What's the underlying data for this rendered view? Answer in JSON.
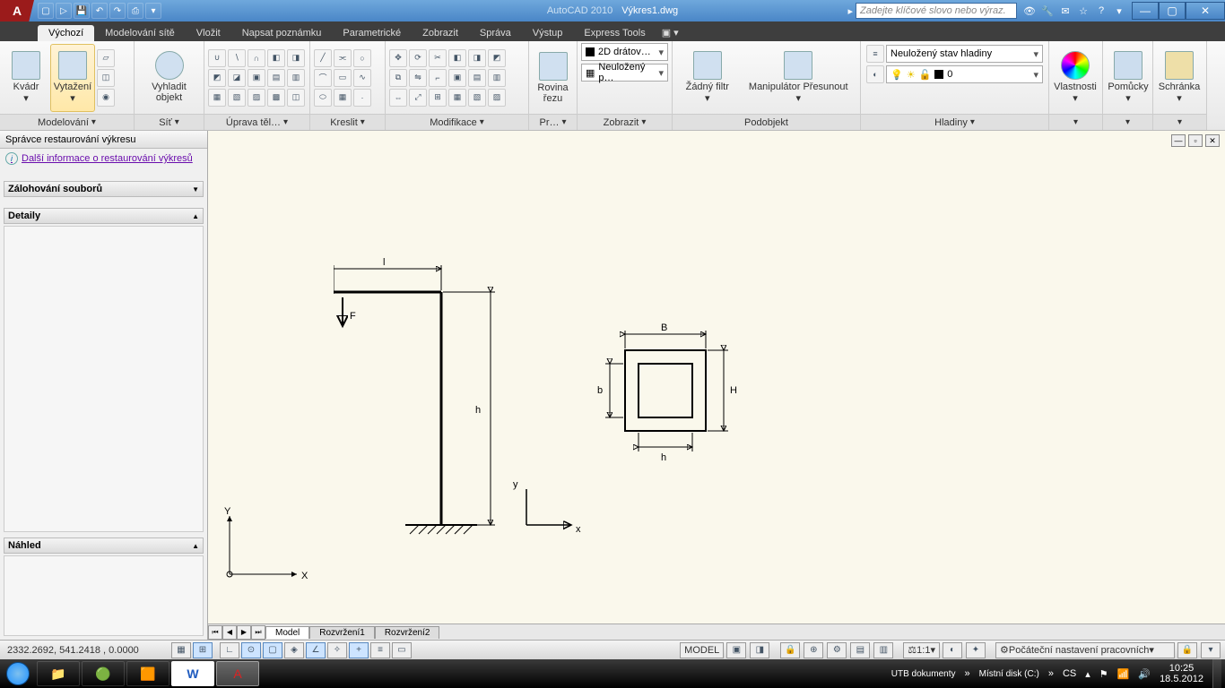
{
  "titlebar": {
    "app_name": "AutoCAD 2010",
    "doc_name": "Výkres1.dwg",
    "search_placeholder": "Zadejte klíčové slovo nebo výraz."
  },
  "tabs": {
    "items": [
      "Výchozí",
      "Modelování sítě",
      "Vložit",
      "Napsat poznámku",
      "Parametrické",
      "Zobrazit",
      "Správa",
      "Výstup",
      "Express Tools"
    ],
    "active_index": 0
  },
  "ribbon": {
    "panels": {
      "modeling": {
        "title": "Modelování",
        "btn1": "Kvádr",
        "btn2": "Vytažení",
        "btn3": "Vyhladit objekt"
      },
      "mesh": {
        "title": "Síť"
      },
      "edit": {
        "title": "Úprava těl…"
      },
      "draw": {
        "title": "Kreslit"
      },
      "modify": {
        "title": "Modifikace"
      },
      "section": {
        "title": "Pr…",
        "btn": "Rovina řezu"
      },
      "view": {
        "title": "Zobrazit",
        "combo1": "2D drátov…",
        "combo2": "Neuložený p…"
      },
      "subobject": {
        "title": "Podobjekt",
        "btn1": "Žádný filtr",
        "btn2": "Manipulátor Přesunout"
      },
      "layers": {
        "title": "Hladiny",
        "state": "Neuložený stav hladiny",
        "current": "0"
      },
      "props": {
        "title": "Vlastnosti"
      },
      "utils": {
        "title": "Pomůcky"
      },
      "clip": {
        "title": "Schránka"
      }
    }
  },
  "drm": {
    "title": "Správce restaurování výkresu",
    "link": "Další informace o restaurování výkresů",
    "section_backup": "Zálohování souborů",
    "section_details": "Detaily",
    "section_preview": "Náhled"
  },
  "drawing": {
    "labels": {
      "l": "l",
      "F": "F",
      "h": "h",
      "B": "B",
      "H": "H",
      "b_small": "b",
      "h_small": "h",
      "y": "y",
      "x": "x",
      "Y": "Y",
      "X": "X"
    }
  },
  "model_tabs": [
    "Model",
    "Rozvržení1",
    "Rozvržení2"
  ],
  "statusbar": {
    "coords": "2332.2692, 541.2418 , 0.0000",
    "model": "MODEL",
    "scale": "1:1",
    "workspace": "Počáteční nastavení pracovních"
  },
  "taskbar": {
    "pins": [
      "UTB dokumenty",
      "Místní disk (C:)"
    ],
    "lang": "CS",
    "time": "10:25",
    "date": "18.5.2012"
  }
}
